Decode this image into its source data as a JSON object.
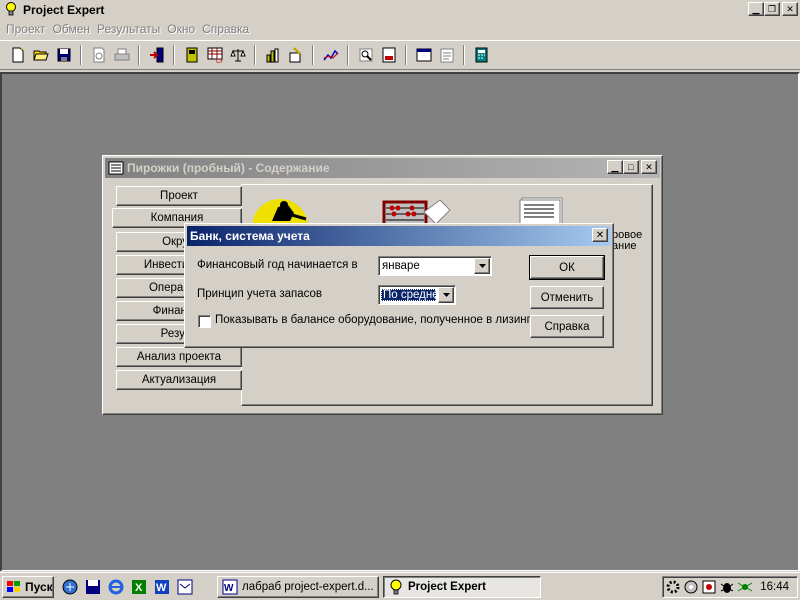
{
  "app": {
    "title": "Project Expert",
    "menu": [
      "Проект",
      "Обмен",
      "Результаты",
      "Окно",
      "Справка"
    ]
  },
  "toolbar": {
    "icons": [
      "new-file-icon",
      "open-folder-icon",
      "save-icon",
      "print-preview-icon",
      "print-icon",
      "exit-icon",
      "calendar-icon",
      "cashflow-table-icon",
      "balance-scale-icon",
      "bar-chart-icon",
      "chart-edit-icon",
      "line-chart-icon",
      "analysis-icon",
      "report-icon",
      "window-icon",
      "clipboard-icon",
      "calculator-icon"
    ]
  },
  "content_window": {
    "title": "Пирожки (пробный) - Содержание",
    "tabs": [
      "Проект",
      "Компания",
      "Окружение",
      "Инвестиционный план",
      "Операционный план",
      "Финансирование",
      "Результаты",
      "Анализ проекта",
      "Актуализация"
    ],
    "tab_visible": [
      "Проект",
      "Компания",
      "Окруж",
      "Инвестицион",
      "Операцион",
      "Финансир",
      "Резуль",
      "Анализ проекта",
      "Актуализация"
    ],
    "active_tab": "Компания",
    "doc_label_line1": "ровое",
    "doc_label_line2": "ание"
  },
  "dialog": {
    "title": "Банк, система учета",
    "fiscal_year_label": "Финансовый год начинается в",
    "fiscal_year_value": "январе",
    "inventory_label": "Принцип учета запасов",
    "inventory_value": "По средней",
    "inventory_visible": "По средне",
    "leasing_checkbox_label": "Показывать в балансе оборудование, полученное в лизинг",
    "leasing_checked": false,
    "ok_label": "ОК",
    "cancel_label": "Отменить",
    "help_label": "Справка"
  },
  "taskbar": {
    "start_label": "Пуск",
    "tasks": [
      "лабраб project-expert.d...",
      "Project Expert"
    ],
    "active_task": "Project Expert",
    "clock": "16:44"
  },
  "colors": {
    "active_title": "#0a246a",
    "inactive_title": "#808080",
    "workspace": "#808080",
    "face": "#d4d0c8"
  }
}
